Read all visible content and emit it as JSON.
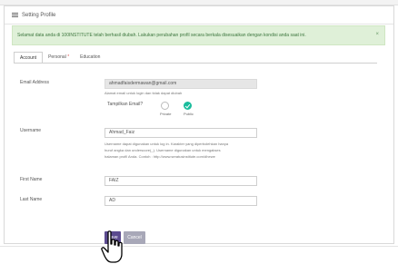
{
  "panel": {
    "title": "Setting Profile",
    "icon": "list-icon"
  },
  "alert": {
    "message": "Selamat data anda di 100INSTITUTE telah berhasil diubah. Lakukan perubahan profil secara berkala disesuaikan dengan kondisi anda saat ini.",
    "close": "×"
  },
  "tabs": [
    {
      "label": "Account",
      "active": true
    },
    {
      "label": "Personal",
      "required": "*"
    },
    {
      "label": "Education"
    }
  ],
  "form": {
    "email_label": "Email Address",
    "email_value": "ahmadfaisdermawan@gmail.com",
    "email_help": "Alamat email untuk login dan tidak dapat diubah",
    "show_email_label": "Tampilkan Email?",
    "radio_private": "Private",
    "radio_public": "Public",
    "username_label": "Username",
    "username_value": "Ahmad_Faiz",
    "username_help_1": "Username dapat digunakan untuk log in. Karakter yang diperbolehkan hanya",
    "username_help_2": "huruf angka dan underscore(_). Username digunakan untuk mengakses",
    "username_help_3": "halaman profil Anda. Contoh : http://www.seratusinstitute.com/dhewe",
    "first_name_label": "First Name",
    "first_name_value": "FAIZ",
    "last_name_label": "Last Name",
    "last_name_value": "AD"
  },
  "buttons": {
    "save": "Save",
    "cancel": "Cancel"
  },
  "colors": {
    "alert_bg": "#dff0d8",
    "save_bg": "#5b4a8f",
    "radio_checked": "#1abc9c"
  }
}
